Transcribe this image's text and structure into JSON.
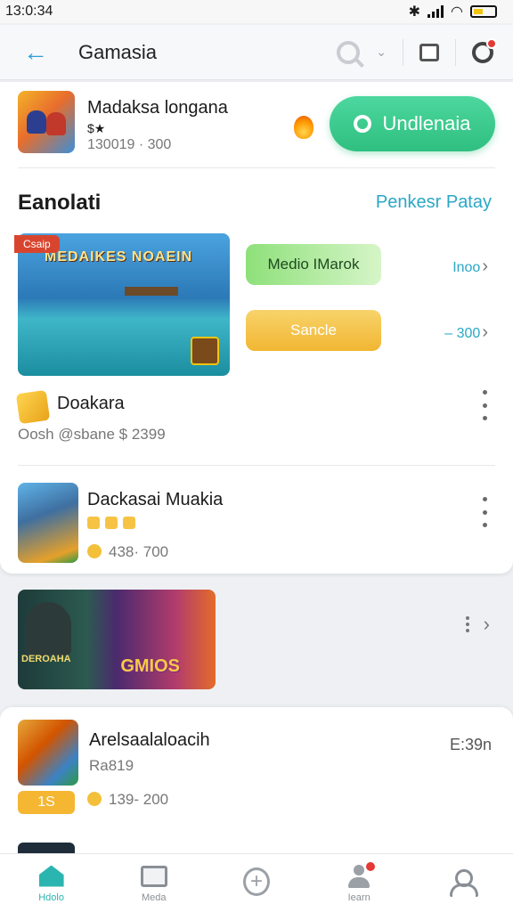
{
  "status_bar": {
    "time": "13:0:34"
  },
  "top_bar": {
    "title": "Gamasia"
  },
  "card_main": {
    "app1": {
      "name": "Madaksa longana",
      "stars": "$★",
      "meta": "130019 · 300",
      "button_label": "Undlenaia"
    },
    "section": {
      "title": "Eanolati",
      "link": "Penkesr Patay"
    },
    "featured": {
      "ribbon": "Csaip",
      "banner": "MEDAIKES NOAEIN"
    },
    "options": [
      {
        "label": "Medio IMarok",
        "value": "Inoo"
      },
      {
        "label": "Sancle",
        "value": "– 300"
      }
    ],
    "app2": {
      "name": "Doakara",
      "meta": "Oosh @sbane $ 2399"
    },
    "app3": {
      "name": "Dackasai Muakia",
      "meta": "438· 700"
    }
  },
  "card_2": {
    "label": "DEROAHA",
    "brand": "GMIOS"
  },
  "card_3": {
    "name": "Arelsaalaloacih",
    "sub": "Ra819",
    "right_value": "E:39n",
    "tag": "1S",
    "meta": "139- 200"
  },
  "bottom_nav": [
    {
      "label": "Hdolo"
    },
    {
      "label": "Meda"
    },
    {
      "label": ""
    },
    {
      "label": "Iearn"
    },
    {
      "label": ""
    }
  ],
  "colors": {
    "accent": "#2bb5b0",
    "primary_button": "#2fbf80",
    "link": "#2aa7c6",
    "warning": "#f1b632"
  }
}
